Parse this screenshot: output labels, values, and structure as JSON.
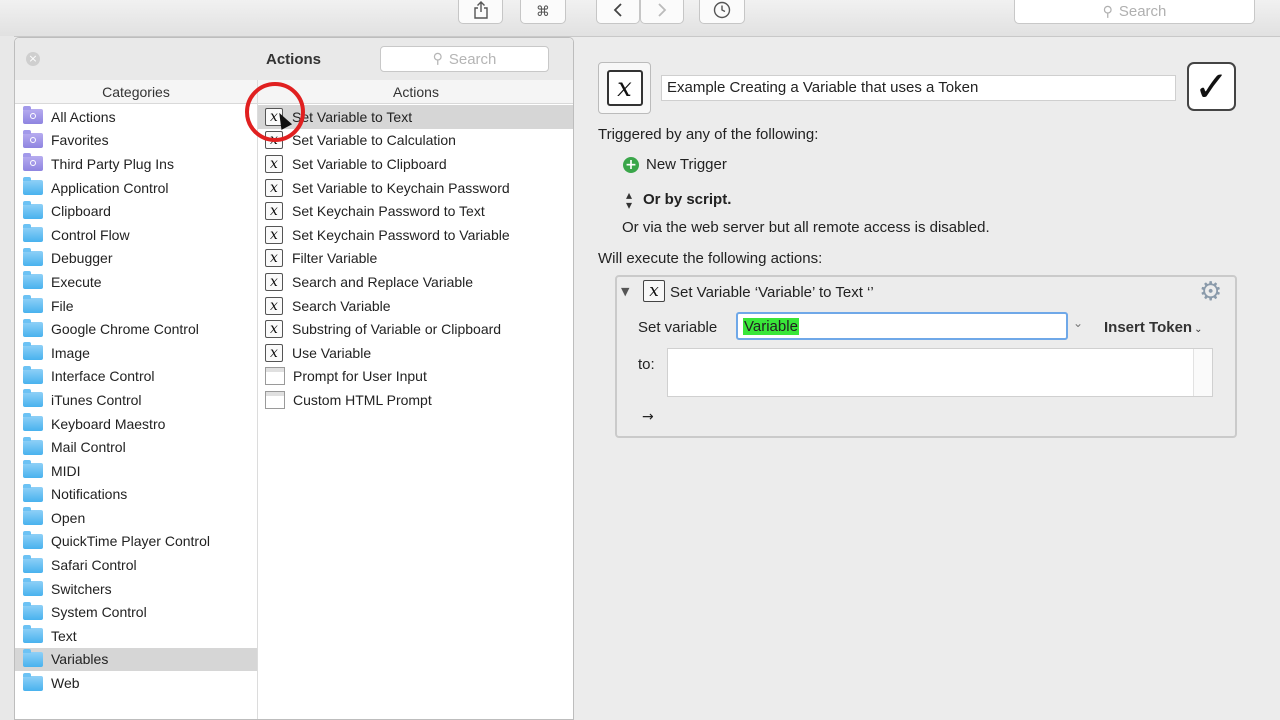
{
  "toolbar": {
    "share_icon": "share-icon",
    "command_icon": "command-icon",
    "command_glyph": "⌘",
    "back_icon": "chevron-left-icon",
    "forward_icon": "chevron-right-icon",
    "history_icon": "clock-icon",
    "search_placeholder": "Search"
  },
  "palette": {
    "title": "Actions",
    "search_placeholder": "Search",
    "categories_header": "Categories",
    "actions_header": "Actions",
    "categories": [
      {
        "label": "All Actions",
        "icon": "smart-folder-icon"
      },
      {
        "label": "Favorites",
        "icon": "smart-folder-icon"
      },
      {
        "label": "Third Party Plug Ins",
        "icon": "smart-folder-icon"
      },
      {
        "label": "Application Control",
        "icon": "folder-icon"
      },
      {
        "label": "Clipboard",
        "icon": "folder-icon"
      },
      {
        "label": "Control Flow",
        "icon": "folder-icon"
      },
      {
        "label": "Debugger",
        "icon": "folder-icon"
      },
      {
        "label": "Execute",
        "icon": "folder-icon"
      },
      {
        "label": "File",
        "icon": "folder-icon"
      },
      {
        "label": "Google Chrome Control",
        "icon": "folder-icon"
      },
      {
        "label": "Image",
        "icon": "folder-icon"
      },
      {
        "label": "Interface Control",
        "icon": "folder-icon"
      },
      {
        "label": "iTunes Control",
        "icon": "folder-icon"
      },
      {
        "label": "Keyboard Maestro",
        "icon": "folder-icon"
      },
      {
        "label": "Mail Control",
        "icon": "folder-icon"
      },
      {
        "label": "MIDI",
        "icon": "folder-icon"
      },
      {
        "label": "Notifications",
        "icon": "folder-icon"
      },
      {
        "label": "Open",
        "icon": "folder-icon"
      },
      {
        "label": "QuickTime Player Control",
        "icon": "folder-icon"
      },
      {
        "label": "Safari Control",
        "icon": "folder-icon"
      },
      {
        "label": "Switchers",
        "icon": "folder-icon"
      },
      {
        "label": "System Control",
        "icon": "folder-icon"
      },
      {
        "label": "Text",
        "icon": "folder-icon"
      },
      {
        "label": "Variables",
        "icon": "folder-icon",
        "selected": true
      },
      {
        "label": "Web",
        "icon": "folder-icon"
      }
    ],
    "actions": [
      {
        "label": "Set Variable to Text",
        "icon": "variable-icon",
        "selected": true
      },
      {
        "label": "Set Variable to Calculation",
        "icon": "variable-icon"
      },
      {
        "label": "Set Variable to Clipboard",
        "icon": "variable-icon"
      },
      {
        "label": "Set Variable to Keychain Password",
        "icon": "variable-icon"
      },
      {
        "label": "Set Keychain Password to Text",
        "icon": "variable-icon"
      },
      {
        "label": "Set Keychain Password to Variable",
        "icon": "variable-icon"
      },
      {
        "label": "Filter Variable",
        "icon": "variable-icon"
      },
      {
        "label": "Search and Replace Variable",
        "icon": "variable-icon"
      },
      {
        "label": "Search Variable",
        "icon": "variable-icon"
      },
      {
        "label": "Substring of Variable or Clipboard",
        "icon": "variable-icon"
      },
      {
        "label": "Use Variable",
        "icon": "variable-icon"
      },
      {
        "label": "Prompt for User Input",
        "icon": "window-icon"
      },
      {
        "label": "Custom HTML Prompt",
        "icon": "window-icon"
      }
    ],
    "icon_glyph": "𝑥"
  },
  "macro": {
    "icon": "variable-icon",
    "name": "Example Creating a Variable that uses a Token",
    "enabled_icon": "checkmark-icon",
    "enabled_glyph": "✓",
    "triggered_label": "Triggered by any of the following:",
    "new_trigger_label": "New Trigger",
    "by_script_label": "Or by script.",
    "web_server_label": "Or via the web server but all remote access is disabled.",
    "will_execute_label": "Will execute the following actions:",
    "action": {
      "title": "Set Variable ‘Variable’ to Text ‘’",
      "set_variable_label": "Set variable",
      "variable_value": "Variable",
      "insert_token_label": "Insert Token",
      "to_label": "to:",
      "to_value": "",
      "gear_icon": "gear-icon"
    }
  },
  "colors": {
    "selection_highlight": "#39e639",
    "annotation_circle": "#e02020",
    "folder": "#49b2ee",
    "smart_folder": "#8e84e0",
    "trigger_plus": "#3aa64a"
  }
}
